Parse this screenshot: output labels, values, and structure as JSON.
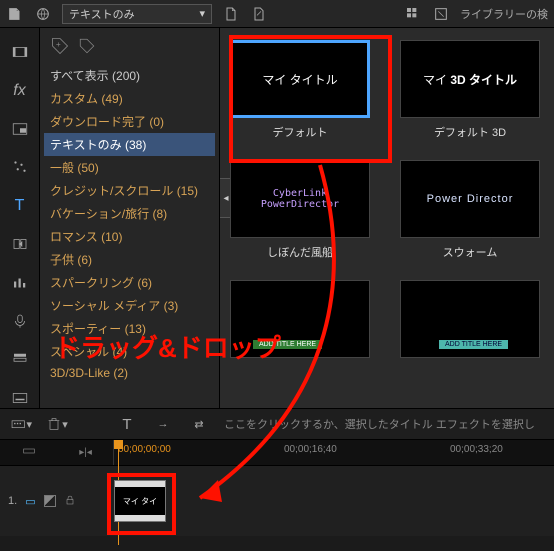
{
  "topbar": {
    "filter_dropdown": "テキストのみ",
    "library_label": "ライブラリーの検"
  },
  "sidebar": {
    "show_all": "すべて表示",
    "show_all_count": "(200)",
    "items": [
      {
        "label": "カスタム",
        "count": "(49)"
      },
      {
        "label": "ダウンロード完了",
        "count": "(0)"
      },
      {
        "label": "テキストのみ",
        "count": "(38)"
      },
      {
        "label": "一般",
        "count": "(50)"
      },
      {
        "label": "クレジット/スクロール",
        "count": "(15)"
      },
      {
        "label": "バケーション/旅行",
        "count": "(8)"
      },
      {
        "label": "ロマンス",
        "count": "(10)"
      },
      {
        "label": "子供",
        "count": "(6)"
      },
      {
        "label": "スパークリング",
        "count": "(6)"
      },
      {
        "label": "ソーシャル メディア",
        "count": "(3)"
      },
      {
        "label": "スポーティー",
        "count": "(13)"
      },
      {
        "label": "スペシャル",
        "count": "(4)"
      },
      {
        "label": "3D/3D-Like",
        "count": "(2)"
      }
    ]
  },
  "gallery": [
    {
      "preview": "マイ タイトル",
      "caption": "デフォルト",
      "selected": true,
      "style": "plain"
    },
    {
      "preview": "マイ 3D タイトル",
      "caption": "デフォルト 3D",
      "selected": false,
      "style": "bold3d"
    },
    {
      "preview": "CyberLink PowerDirector",
      "caption": "しぼんだ風船",
      "selected": false,
      "style": "retro"
    },
    {
      "preview": "Power Director",
      "caption": "スウォーム",
      "selected": false,
      "style": "thin"
    },
    {
      "preview": "ADD TITLE HERE",
      "caption": "",
      "selected": false,
      "style": "lower1"
    },
    {
      "preview": "ADD TITLE HERE",
      "caption": "",
      "selected": false,
      "style": "lower2"
    }
  ],
  "timeline": {
    "hint": "ここをクリックするか、選択したタイトル エフェクトを選択し",
    "timecodes": [
      "00;00;00;00",
      "00;00;16;40",
      "00;00;33;20"
    ],
    "current": "00;00;00;00",
    "track_number": "1.",
    "clip_label": "マイ タイ"
  },
  "annotation": {
    "text": "ドラッグ&ドロップ"
  }
}
